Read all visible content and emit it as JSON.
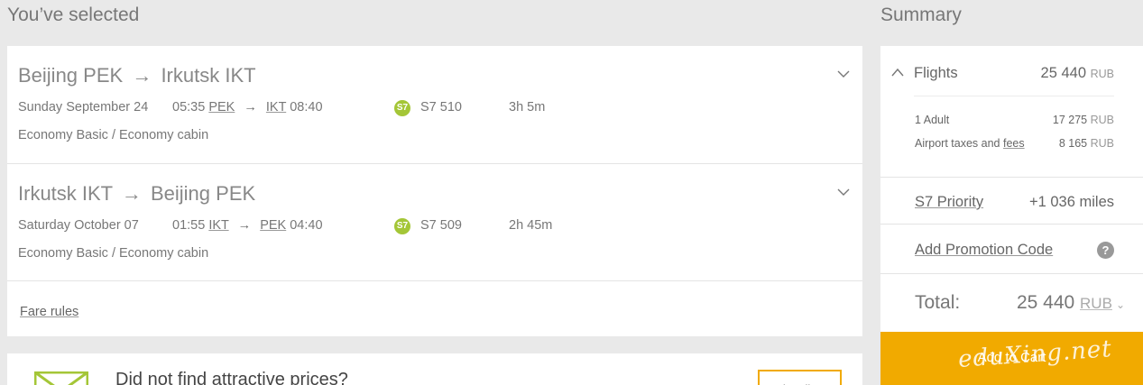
{
  "header": {
    "selected_title": "You’ve selected",
    "summary_title": "Summary"
  },
  "legs": [
    {
      "from": "Beijing PEK",
      "to": "Irkutsk IKT",
      "arrow": "→",
      "date": "Sunday September 24",
      "dep_time": "05:35",
      "dep_code": "PEK",
      "arr_code": "IKT",
      "arr_time": "08:40",
      "airline_logo": "S7",
      "flight": "S7 510",
      "duration": "3h 5m",
      "cabin": "Economy Basic / Economy cabin"
    },
    {
      "from": "Irkutsk IKT",
      "to": "Beijing PEK",
      "arrow": "→",
      "date": "Saturday October 07",
      "dep_time": "01:55",
      "dep_code": "IKT",
      "arr_code": "PEK",
      "arr_time": "04:40",
      "airline_logo": "S7",
      "flight": "S7 509",
      "duration": "2h 45m",
      "cabin": "Economy Basic / Economy cabin"
    }
  ],
  "fare_rules": "Fare rules",
  "promo": {
    "text": "Did not find attractive prices?",
    "button": "Subscribe"
  },
  "summary": {
    "flights_label": "Flights",
    "flights_amount": "25 440",
    "currency": "RUB",
    "adult_label": "1 Adult",
    "adult_amount": "17 275",
    "taxes_label_prefix": "Airport taxes and ",
    "taxes_label_link": "fees",
    "taxes_amount": "8 165",
    "priority_label": "S7 Priority",
    "priority_value": "+1 036 miles",
    "promo_code_label": "Add Promotion Code",
    "help_glyph": "?",
    "total_label": "Total:",
    "total_amount": "25 440",
    "total_currency": "RUB"
  },
  "cart_button": "Add to Cart",
  "watermark": "eduXing.net",
  "colors": {
    "accent": "#f1aa00",
    "s7_green": "#a4c637",
    "background": "#e9e9e9"
  },
  "icons": {
    "expand": "chevron-down-icon",
    "collapse": "chevron-up-icon",
    "airline": "s7-logo-icon",
    "envelope": "envelope-icon",
    "help": "question-circle-icon"
  }
}
